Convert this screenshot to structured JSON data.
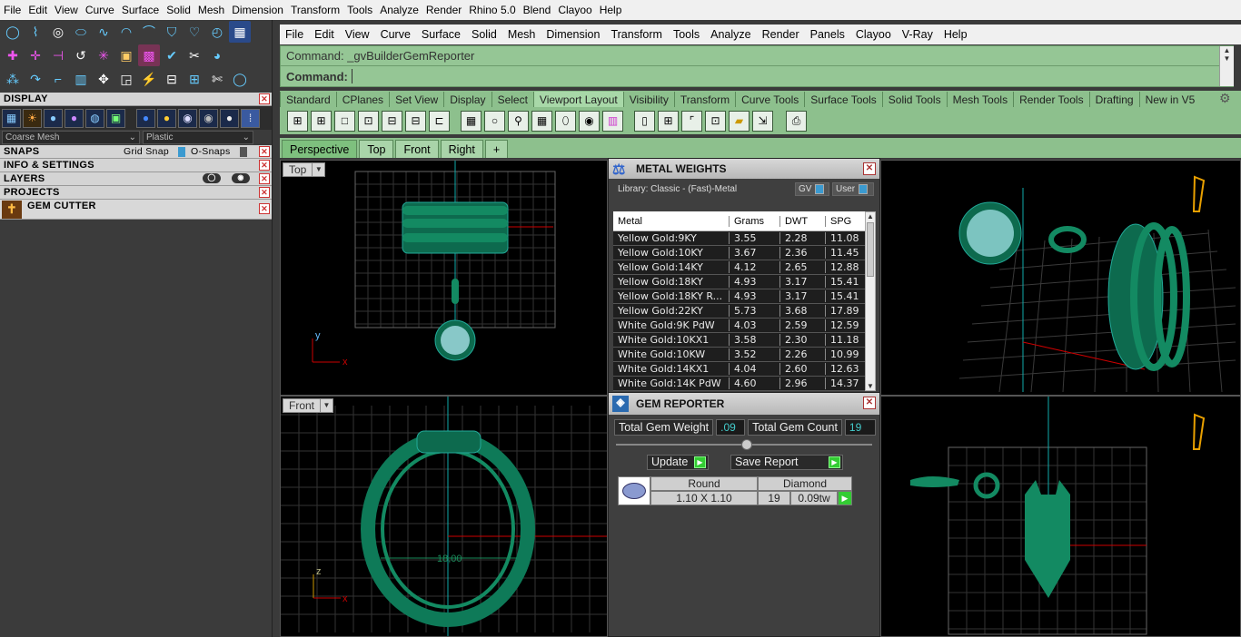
{
  "menubar": [
    "File",
    "Edit",
    "View",
    "Curve",
    "Surface",
    "Solid",
    "Mesh",
    "Dimension",
    "Transform",
    "Tools",
    "Analyze",
    "Render",
    "Rhino 5.0",
    "Blend",
    "Clayoo",
    "Help"
  ],
  "rhino_menu": [
    "File",
    "Edit",
    "View",
    "Curve",
    "Surface",
    "Solid",
    "Mesh",
    "Dimension",
    "Transform",
    "Tools",
    "Analyze",
    "Render",
    "Panels",
    "Clayoo",
    "V-Ray",
    "Help"
  ],
  "left_panel": {
    "display": {
      "title": "DISPLAY",
      "mesh_select": "Coarse Mesh",
      "material_select": "Plastic"
    },
    "snaps": {
      "title": "SNAPS",
      "grid_snap": "Grid Snap",
      "osnaps": "O-Snaps"
    },
    "info": "INFO & SETTINGS",
    "layers": "LAYERS",
    "projects": "PROJECTS",
    "gem_cutter": "GEM CUTTER"
  },
  "command": {
    "line1": "Command: _gvBuilderGemReporter",
    "line2_label": "Command:",
    "line2_value": ""
  },
  "toolbar_tabs": [
    "Standard",
    "CPlanes",
    "Set View",
    "Display",
    "Select",
    "Viewport Layout",
    "Visibility",
    "Transform",
    "Curve Tools",
    "Surface Tools",
    "Solid Tools",
    "Mesh Tools",
    "Render Tools",
    "Drafting",
    "New in V5"
  ],
  "active_toolbar_tab": "Viewport Layout",
  "viewport_tabs": [
    "Perspective",
    "Top",
    "Front",
    "Right",
    "+"
  ],
  "viewports": {
    "top_label": "Top",
    "front_label": "Front",
    "front_dim": "18,00"
  },
  "metal_weights": {
    "title": "METAL WEIGHTS",
    "library": "Library: Classic - (Fast)-Metal",
    "gv_label": "GV",
    "user_label": "User",
    "columns": [
      "Metal",
      "Grams",
      "DWT",
      "SPG"
    ],
    "rows": [
      {
        "metal": "Yellow Gold:9KY",
        "grams": "3.55",
        "dwt": "2.28",
        "spg": "11.08"
      },
      {
        "metal": "Yellow Gold:10KY",
        "grams": "3.67",
        "dwt": "2.36",
        "spg": "11.45"
      },
      {
        "metal": "Yellow Gold:14KY",
        "grams": "4.12",
        "dwt": "2.65",
        "spg": "12.88"
      },
      {
        "metal": "Yellow Gold:18KY",
        "grams": "4.93",
        "dwt": "3.17",
        "spg": "15.41"
      },
      {
        "metal": "Yellow Gold:18KY R...",
        "grams": "4.93",
        "dwt": "3.17",
        "spg": "15.41"
      },
      {
        "metal": "Yellow Gold:22KY",
        "grams": "5.73",
        "dwt": "3.68",
        "spg": "17.89"
      },
      {
        "metal": "White Gold:9K PdW",
        "grams": "4.03",
        "dwt": "2.59",
        "spg": "12.59"
      },
      {
        "metal": "White Gold:10KX1",
        "grams": "3.58",
        "dwt": "2.30",
        "spg": "11.18"
      },
      {
        "metal": "White Gold:10KW",
        "grams": "3.52",
        "dwt": "2.26",
        "spg": "10.99"
      },
      {
        "metal": "White Gold:14KX1",
        "grams": "4.04",
        "dwt": "2.60",
        "spg": "12.63"
      },
      {
        "metal": "White Gold:14K PdW",
        "grams": "4.60",
        "dwt": "2.96",
        "spg": "14.37"
      }
    ]
  },
  "gem_reporter": {
    "title": "GEM REPORTER",
    "total_weight_label": "Total Gem Weight",
    "total_weight_value": ".09",
    "total_count_label": "Total Gem Count",
    "total_count_value": "19",
    "update_label": "Update",
    "save_label": "Save Report",
    "gem": {
      "shape": "Round",
      "type": "Diamond",
      "size": "1.10 X 1.10",
      "count": "19",
      "weight": "0.09tw"
    }
  }
}
